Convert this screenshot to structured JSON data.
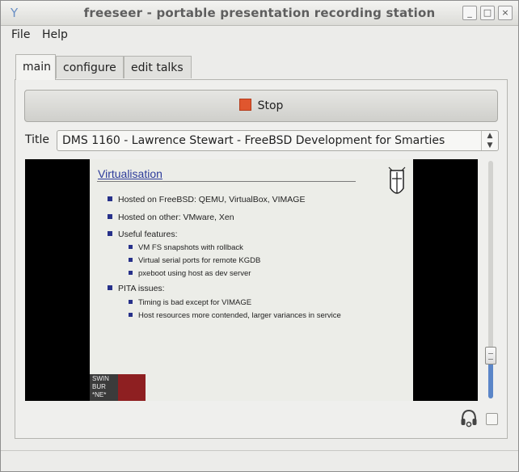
{
  "window": {
    "title": "freeseer - portable presentation recording station",
    "minimize": "_",
    "maximize": "□",
    "close": "×"
  },
  "menu": {
    "items": [
      "File",
      "Help"
    ]
  },
  "tabs": [
    {
      "label": "main",
      "active": true
    },
    {
      "label": "configure",
      "active": false
    },
    {
      "label": "edit talks",
      "active": false
    }
  ],
  "main": {
    "stop_label": "Stop",
    "title_label": "Title",
    "selected_talk": "DMS 1160 - Lawrence Stewart - FreeBSD Development for Smarties",
    "select_arrow_up": "▲",
    "select_arrow_down": "▼",
    "audio_icon": "headphones-icon"
  },
  "slide": {
    "title": "Virtualisation",
    "bullets": [
      {
        "text": "Hosted on FreeBSD: QEMU, VirtualBox, VIMAGE",
        "level": 1
      },
      {
        "text": "Hosted on other: VMware, Xen",
        "level": 1
      },
      {
        "text": "Useful features:",
        "level": 1
      },
      {
        "text": "VM FS snapshots with rollback",
        "level": 2
      },
      {
        "text": "Virtual serial ports for remote KGDB",
        "level": 2
      },
      {
        "text": "pxeboot using host as dev server",
        "level": 2
      },
      {
        "text": "PITA issues:",
        "level": 1
      },
      {
        "text": "Timing is bad except for VIMAGE",
        "level": 2
      },
      {
        "text": "Host resources more contended, larger variances in service",
        "level": 2
      }
    ],
    "logo_text": "SWIN BUR *NE*"
  },
  "colors": {
    "stop": "#e0562e",
    "slide_title": "#2b3a9a",
    "bullet": "#27318a",
    "scroll_fill": "#5b86c8"
  }
}
